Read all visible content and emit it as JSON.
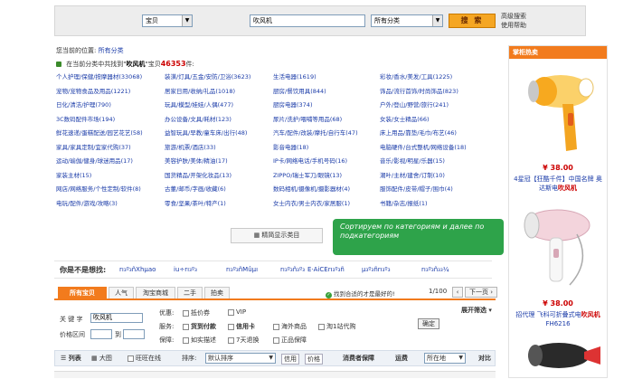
{
  "search": {
    "type_value": "宝贝",
    "keyword": "吹风机",
    "category_value": "所有分类",
    "button": "搜 索",
    "adv_link": "高级搜索",
    "help_link": "使用帮助"
  },
  "breadcrumb": {
    "label": "您当前的位置:",
    "current": "所有分类"
  },
  "found": {
    "pre": "在当前分类中共找到\"",
    "keyword": "吹风机",
    "mid": "\"宝贝",
    "count": "46353",
    "post": "件:"
  },
  "categories": [
    [
      "个人护理/保健/按摩器材(33068)",
      "装潢/灯具/五金/安防/卫浴(3623)",
      "生活电器(1619)",
      "彩妆/香水/美发/工具(1225)"
    ],
    [
      "宠物/宠物食品及用品(1221)",
      "居家日用/收纳/礼品(1018)",
      "厨房/餐饮用具(844)",
      "饰品/流行首饰/时尚饰品(823)"
    ],
    [
      "日化/清洁/护理(790)",
      "玩具/模型/娃娃/人偶(477)",
      "厨房电器(374)",
      "户外/登山/野营/旅行(241)"
    ],
    [
      "3C数码配件市场(194)",
      "办公设备/文具/耗材(123)",
      "尿片/洗护/喂哺等用品(68)",
      "女装/女士精品(66)"
    ],
    [
      "鲜花速递/蛋糕配送/园艺花艺(58)",
      "益智玩具/早教/童车床/出行(48)",
      "汽车/配件/改装/摩托/自行车(47)",
      "床上用品/靠垫/毛巾/布艺(46)"
    ],
    [
      "家具/家具定制/宜家代购(37)",
      "旅游/机票/酒店(33)",
      "影音电器(18)",
      "电脑硬件/台式整机/网络设备(18)"
    ],
    [
      "运动/瑜伽/健身/球迷用品(17)",
      "美容护肤/美体/精油(17)",
      "IP卡/网络电话/手机号码(16)",
      "音乐/影视/明星/乐器(15)"
    ],
    [
      "家装主材(15)",
      "国货精品/开架化妆品(13)",
      "ZIPPO/瑞士军刀/眼镜(13)",
      "潮叶/主材/建舍/订制(10)"
    ],
    [
      "网店/网络服务/个性定制/软件(8)",
      "古董/邮币/字画/收藏(6)",
      "数码相机/摄像机/摄影器材(4)",
      "服饰配件/皮带/帽子/围巾(4)"
    ],
    [
      "电玩/配件/游戏/攻略(3)",
      "零食/坚果/茶叶/特产(1)",
      "女士内衣/男士内衣/家居服(1)",
      "书籍/杂志/报纸(1)"
    ]
  ],
  "more_button": "精简显示类目",
  "tooltip": "Сортируем по категориям и далее по подкатегориям",
  "guess": {
    "title": "你是不是想找:",
    "links": [
      "rı₃º₃ñXhµao",
      "iu÷rı₃º₃",
      "rı₃º₃ñMûµı",
      "rı₃º₃ñ₃º₃",
      "E·AiCErı₃º₃ñ",
      "µ₃º₃ñrı₃º₃",
      "rı₃º₃ñ₃₃¼"
    ]
  },
  "tabs": [
    "所有宝贝",
    "人气",
    "淘宝商城",
    "二手",
    "拍卖"
  ],
  "hint": "找到合适的才是最好的!",
  "pager": {
    "current": "1/100",
    "prev": "‹",
    "next": "下一页 ›"
  },
  "filter": {
    "keyword_label": "关 键 字",
    "keyword_value": "吹风机",
    "price_label": "价格区间",
    "price_from": "",
    "price_sep": "到",
    "price_to": "",
    "promo_label": "优惠:",
    "promo_options": [
      "抵价券",
      "VIP"
    ],
    "service_label": "服务:",
    "service_options": [
      "货到付款",
      "信用卡",
      "海外商品",
      "淘1站代购"
    ],
    "guarantee_label": "保障:",
    "guarantee_options": [
      "如实描述",
      "7天退换",
      "正品保障"
    ],
    "ok_button": "确定",
    "expand": "展开筛选 ▾"
  },
  "sortbar": {
    "list_view": "列表",
    "big_view": "大图",
    "wangwang": "旺旺在线",
    "sort_label": "排序:",
    "sort_value": "默认排序",
    "credit": "信用",
    "price": "价格",
    "consumer": "消费者保障",
    "shipping": "运费",
    "location_value": "所在地",
    "compare": "对比"
  },
  "sidebar": {
    "title": "掌柜热卖",
    "products": [
      {
        "price": "¥ 38.00",
        "desc_pre": "4星冠【狂酷千件】中国名牌 奥达斯电",
        "desc_hl": "吹风机",
        "desc_post": ""
      },
      {
        "price": "¥ 38.00",
        "desc_pre": "招代理 飞科可折叠式电",
        "desc_hl": "吹风机",
        "desc_post": " FH6216"
      }
    ]
  }
}
